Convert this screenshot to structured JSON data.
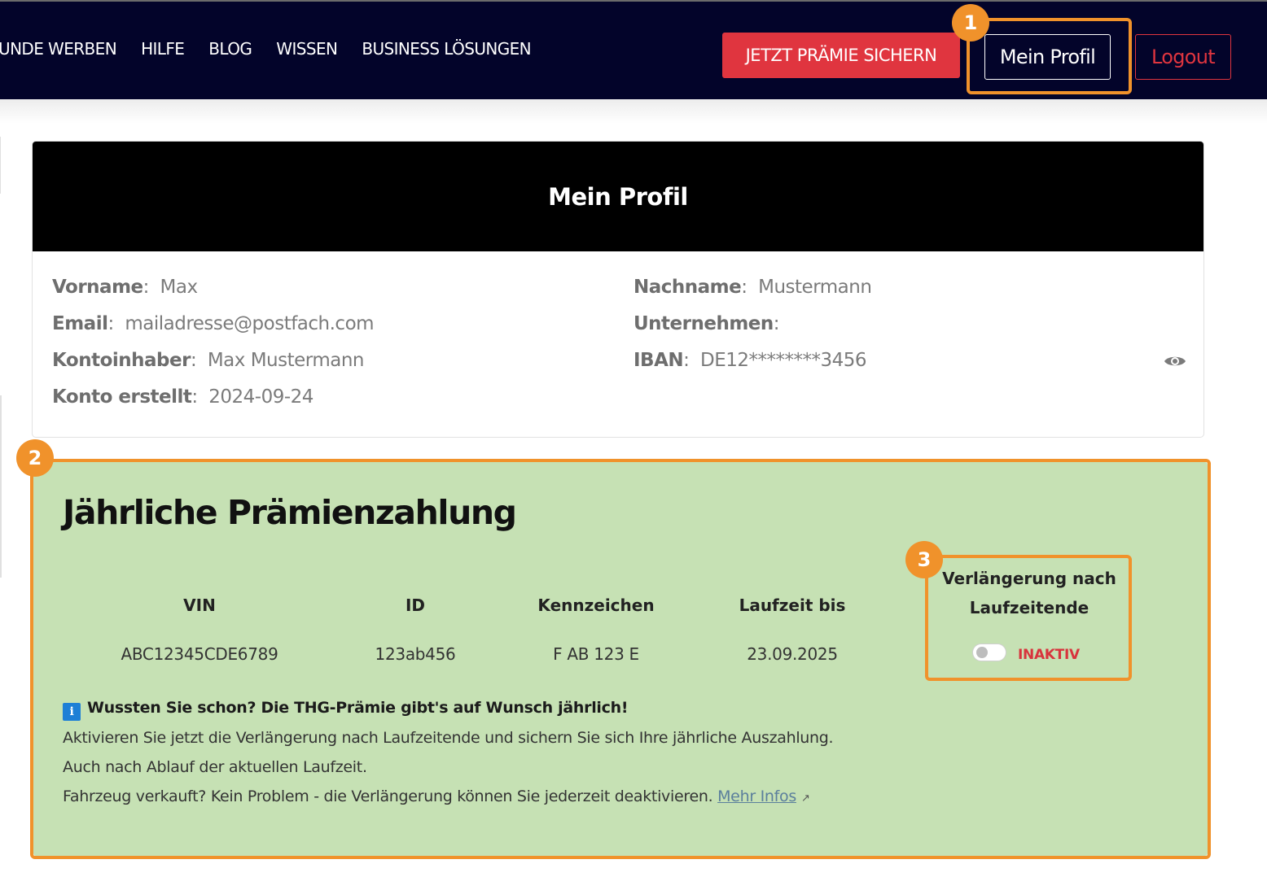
{
  "nav": {
    "links": [
      "EUNDE WERBEN",
      "HILFE",
      "BLOG",
      "WISSEN",
      "BUSINESS LÖSUNGEN"
    ],
    "praemie_label": "JETZT PRÄMIE SICHERN",
    "profil_label": "Mein Profil",
    "logout_label": "Logout"
  },
  "callouts": [
    "1",
    "2",
    "3"
  ],
  "profile": {
    "title": "Mein Profil",
    "vorname_label": "Vorname",
    "vorname_value": "Max",
    "nachname_label": "Nachname",
    "nachname_value": "Mustermann",
    "email_label": "Email",
    "email_value": "mailadresse@postfach.com",
    "unternehmen_label": "Unternehmen",
    "unternehmen_value": "",
    "kontoinhaber_label": "Kontoinhaber",
    "kontoinhaber_value": "Max Mustermann",
    "iban_label": "IBAN",
    "iban_value": "DE12********3456",
    "konto_label": "Konto erstellt",
    "konto_value": "2024-09-24",
    "eye_icon": "eye-icon"
  },
  "praemie": {
    "title": "Jährliche Prämienzahlung",
    "columns": {
      "vin": "VIN",
      "id": "ID",
      "kennzeichen": "Kennzeichen",
      "laufzeit": "Laufzeit bis",
      "verl_line1": "Verlängerung nach",
      "verl_line2": "Laufzeitende"
    },
    "row": {
      "vin": "ABC12345CDE6789",
      "id": "123ab456",
      "kennzeichen": "F AB 123 E",
      "laufzeit": "23.09.2025",
      "toggle_on": false,
      "status": "INAKTIV"
    },
    "info": {
      "icon": "info-icon",
      "headline": "Wussten Sie schon? Die THG-Prämie gibt's auf Wunsch jährlich!",
      "line1": "Aktivieren Sie jetzt die Verlängerung nach Laufzeitende und sichern Sie sich Ihre jährliche Auszahlung.",
      "line2": "Auch nach Ablauf der aktuellen Laufzeit.",
      "line3": "Fahrzeug verkauft? Kein Problem - die Verlängerung können Sie jederzeit deaktivieren.",
      "link": "Mehr Infos",
      "link_icon": "external-link-icon"
    }
  },
  "colors": {
    "nav_bg": "#03042a",
    "accent_red": "#e0353f",
    "highlight_orange": "#f0922b",
    "praemie_bg": "#c6e1b4"
  }
}
